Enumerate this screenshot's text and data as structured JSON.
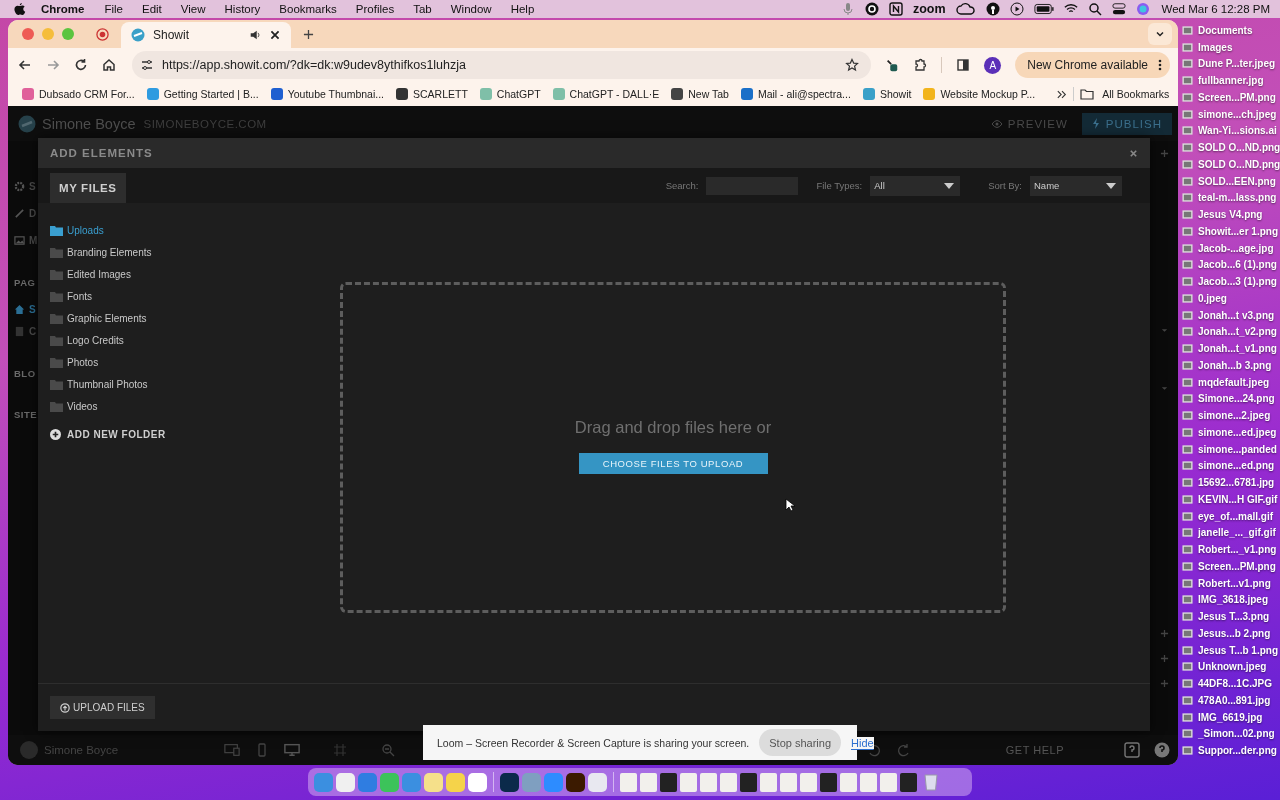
{
  "menu_bar": {
    "app": "Chrome",
    "menus": [
      "File",
      "Edit",
      "View",
      "History",
      "Bookmarks",
      "Profiles",
      "Tab",
      "Window",
      "Help"
    ],
    "zoom_label": "zoom",
    "clock": "Wed Mar 6  12:28 PM"
  },
  "browser": {
    "tabs": [
      {
        "title": "Showit",
        "selected": true,
        "playing_audio": true
      }
    ],
    "url": "https://app.showit.com/?dk=dk:w9udev8ythifkos1luhzja",
    "avatar": "A",
    "update_button": "New Chrome available",
    "bookmarks": [
      {
        "title": "Dubsado CRM For...",
        "color": "#e0609a"
      },
      {
        "title": "Getting Started | B...",
        "color": "#2f9be0"
      },
      {
        "title": "Youtube Thumbnai...",
        "color": "#1f5fd0"
      },
      {
        "title": "SCARLETT",
        "color": "#333333"
      },
      {
        "title": "ChatGPT",
        "color": "#7fbfa8"
      },
      {
        "title": "ChatGPT - DALL·E",
        "color": "#7fbfa8"
      },
      {
        "title": "New Tab",
        "color": "#444444"
      },
      {
        "title": "Mail - ali@spectra...",
        "color": "#1a6fc8"
      },
      {
        "title": "Showit",
        "color": "#3aa0c8"
      },
      {
        "title": "Website Mockup P...",
        "color": "#f2b41c"
      }
    ],
    "all_bookmarks": "All Bookmarks"
  },
  "app": {
    "site_name": "Simone Boyce",
    "site_domain": "SIMONEBOYCE.COM",
    "preview": "PREVIEW",
    "publish": "PUBLISH",
    "nav": [
      {
        "kind": "gear",
        "label": "S"
      },
      {
        "kind": "pencil",
        "label": "D"
      },
      {
        "kind": "image",
        "label": "M"
      }
    ],
    "pages_heading": "PAG",
    "pages": [
      {
        "kind": "home",
        "label": "S",
        "selected": true
      },
      {
        "kind": "page",
        "label": "C",
        "selected": false
      }
    ],
    "blog_heading": "BLO",
    "site_heading": "SITE",
    "user_name": "Simone Boyce",
    "help": "GET HELP"
  },
  "modal": {
    "title": "ADD ELEMENTS",
    "tabs": [
      {
        "label": "MY FILES",
        "selected": true
      }
    ],
    "search_label": "Search:",
    "file_types_label": "File Types:",
    "file_types_value": "All",
    "sort_label": "Sort By:",
    "sort_value": "Name",
    "folders": [
      {
        "name": "Uploads",
        "selected": true
      },
      {
        "name": "Branding Elements",
        "selected": false
      },
      {
        "name": "Edited Images",
        "selected": false
      },
      {
        "name": "Fonts",
        "selected": false
      },
      {
        "name": "Graphic Elements",
        "selected": false
      },
      {
        "name": "Logo Credits",
        "selected": false
      },
      {
        "name": "Photos",
        "selected": false
      },
      {
        "name": "Thumbnail Photos",
        "selected": false
      },
      {
        "name": "Videos",
        "selected": false
      }
    ],
    "add_folder": "ADD NEW FOLDER",
    "drop_text": "Drag and drop files here or",
    "choose_button": "CHOOSE FILES TO UPLOAD",
    "upload_button": "UPLOAD FILES"
  },
  "loom_bar": {
    "message": "Loom – Screen Recorder & Screen Capture is sharing your screen.",
    "stop": "Stop sharing",
    "hide": "Hide"
  },
  "desktop_files": [
    "Documents",
    "Images",
    "Dune P...ter.jpeg",
    "fullbanner.jpg",
    "Screen...PM.png",
    "simone...ch.jpeg",
    "Wan-Yi...sions.ai",
    "SOLD O...ND.png",
    "SOLD O...ND.png",
    "SOLD...EEN.png",
    "teal-m...lass.png",
    "Jesus V4.png",
    "Showit...er 1.png",
    "Jacob-...age.jpg",
    "Jacob...6 (1).png",
    "Jacob...3 (1).png",
    "0.jpeg",
    "Jonah...t v3.png",
    "Jonah...t_v2.png",
    "Jonah...t_v1.png",
    "Jonah...b 3.png",
    "mqdefault.jpeg",
    "Simone...24.png",
    "simone...2.jpeg",
    "simone...ed.jpeg",
    "simone...panded",
    "simone...ed.png",
    "15692...6781.jpg",
    "KEVIN...H GIF.gif",
    "eye_of...mall.gif",
    "janelle_..._gif.gif",
    "Robert..._v1.png",
    "Screen...PM.png",
    "Robert...v1.png",
    "IMG_3618.jpeg",
    "Jesus T...3.png",
    "Jesus...b 2.png",
    "Jesus T...b 1.png",
    "Unknown.jpeg",
    "44DF8...1C.JPG",
    "478A0...891.jpg",
    "IMG_6619.jpg",
    "_Simon...02.png",
    "Suppor...der.png"
  ]
}
